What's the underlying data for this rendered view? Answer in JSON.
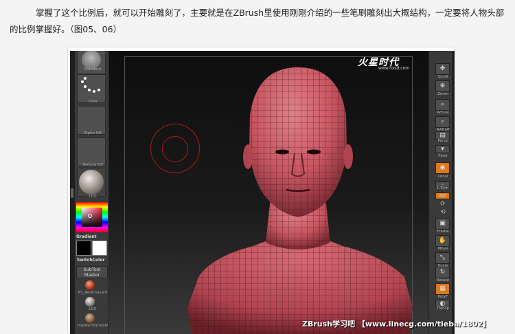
{
  "article": {
    "paragraph": "掌握了这个比例后，就可以开始雕刻了，主要就是在ZBrush里使用刚刚介绍的一些笔刷雕刻出大概结构，一定要将人物头部的比例掌握好。（图05、06）"
  },
  "left_panel": {
    "brush_label": "Standard",
    "stroke_label": "Dots",
    "alpha_label": "Alpha Off",
    "texture_label": "Texture Off",
    "material_label": "LCO",
    "gradient_label": "Gradient",
    "switchcolor_label": "SwitchColor",
    "subtool_label_line1": "SubTool",
    "subtool_label_line2": "Master",
    "mat1_label": "RS_RedChavant",
    "mat2_label": "LCO",
    "mat3_label": "matAsmTurntabl"
  },
  "right_panel": {
    "scroll": "Scroll",
    "zoom": "Zoom",
    "actual": "Actual",
    "aahalf": "AAHalf",
    "persp": "Persp",
    "floor": "Floor",
    "local": "Local",
    "lsym": "L.Sym",
    "xyz": "xyz",
    "frame": "Frame",
    "move": "Move",
    "scale": "Scale",
    "rotate": "Rotate",
    "polyf": "PolyF",
    "transp": "Transp"
  },
  "logo": {
    "text": "火星时代",
    "sub": "www.hxsd.com"
  },
  "watermark": "ZBrush学习吧 【www.linecg.com/tieba/1802】",
  "colors": {
    "accent": "#e07818",
    "brush_ring": "#b01818",
    "model": "#c65560"
  }
}
